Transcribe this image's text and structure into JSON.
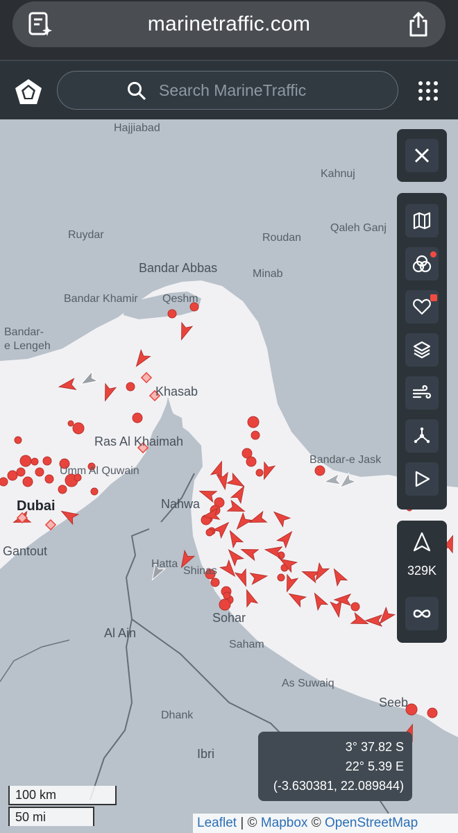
{
  "browser": {
    "url": "marinetraffic.com"
  },
  "header": {
    "search_placeholder": "Search MarineTraffic"
  },
  "map": {
    "places": [
      {
        "id": "hajjiabad",
        "label": "Hajjiabad"
      },
      {
        "id": "kahnuj",
        "label": "Kahnuj"
      },
      {
        "id": "ruydar",
        "label": "Ruydar"
      },
      {
        "id": "qaleh-ganj",
        "label": "Qaleh Ganj"
      },
      {
        "id": "roudan",
        "label": "Roudan"
      },
      {
        "id": "bandar-abbas",
        "label": "Bandar Abbas"
      },
      {
        "id": "minab",
        "label": "Minab"
      },
      {
        "id": "bandar-khamir",
        "label": "Bandar Khamir"
      },
      {
        "id": "qeshm",
        "label": "Qeshm"
      },
      {
        "id": "bandar-e-lengeh-1",
        "label": "Bandar-"
      },
      {
        "id": "bandar-e-lengeh-2",
        "label": "e Lengeh"
      },
      {
        "id": "khasab",
        "label": "Khasab"
      },
      {
        "id": "ras-al-khaimah",
        "label": "Ras Al Khaimah"
      },
      {
        "id": "bandar-e-jask",
        "label": "Bandar-e Jask"
      },
      {
        "id": "umm-al-quwain",
        "label": "Umm Al Quwain"
      },
      {
        "id": "dubai",
        "label": "Dubai"
      },
      {
        "id": "nahwa",
        "label": "Nahwa"
      },
      {
        "id": "gantout",
        "label": "Gantout"
      },
      {
        "id": "hatta",
        "label": "Hatta"
      },
      {
        "id": "shinas",
        "label": "Shinas"
      },
      {
        "id": "sohar",
        "label": "Sohar"
      },
      {
        "id": "al-ain",
        "label": "Al Ain"
      },
      {
        "id": "saham",
        "label": "Saham"
      },
      {
        "id": "as-suwaiq",
        "label": "As Suwaiq"
      },
      {
        "id": "seeb",
        "label": "Seeb"
      },
      {
        "id": "dhank",
        "label": "Dhank"
      },
      {
        "id": "ibri",
        "label": "Ibri"
      }
    ],
    "fleet_count": "329K",
    "coordinates": {
      "lat": "3° 37.82 S",
      "lon": "22° 5.39 E",
      "decimal": "(-3.630381, 22.089844)"
    },
    "scale_km": "100 km",
    "scale_mi": "50 mi",
    "attribution": {
      "leaflet": "Leaflet",
      "sep1": " | © ",
      "mapbox": "Mapbox",
      "sep2": " © ",
      "osm": "OpenStreetMap"
    },
    "colors": {
      "vessel": "#e8443d",
      "land": "#b9c1ca",
      "sea": "#f1f1f4"
    }
  },
  "controls": {
    "close": "close-icon",
    "tools": [
      "map-icon",
      "filters-icon",
      "favorites-icon",
      "layers-icon",
      "weather-icon",
      "routes-icon",
      "play-icon"
    ],
    "fleet": [
      "navigate-icon",
      "infinity-icon"
    ]
  }
}
